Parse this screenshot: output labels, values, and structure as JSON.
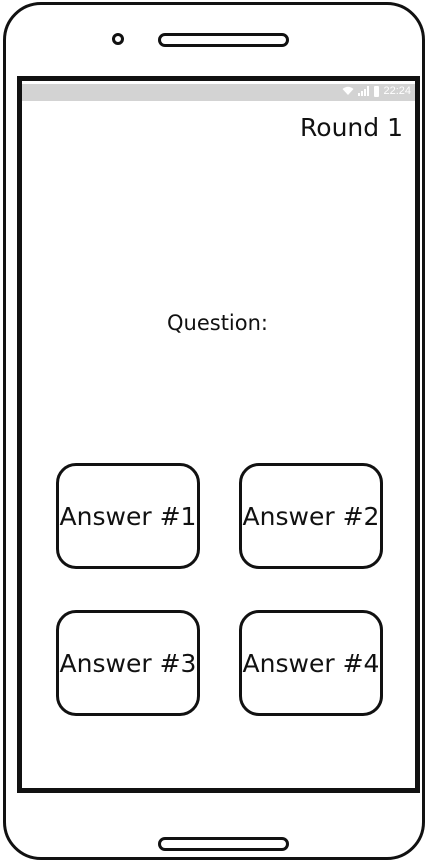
{
  "status_bar": {
    "time": "22:24",
    "icons": [
      "wifi-icon",
      "signal-icon",
      "battery-icon"
    ],
    "background_color": "#d3d3d3"
  },
  "header": {
    "round": "Round 1"
  },
  "question": {
    "label": "Question:"
  },
  "answers": [
    {
      "label": "Answer #1"
    },
    {
      "label": "Answer #2"
    },
    {
      "label": "Answer #3"
    },
    {
      "label": "Answer #4"
    }
  ]
}
